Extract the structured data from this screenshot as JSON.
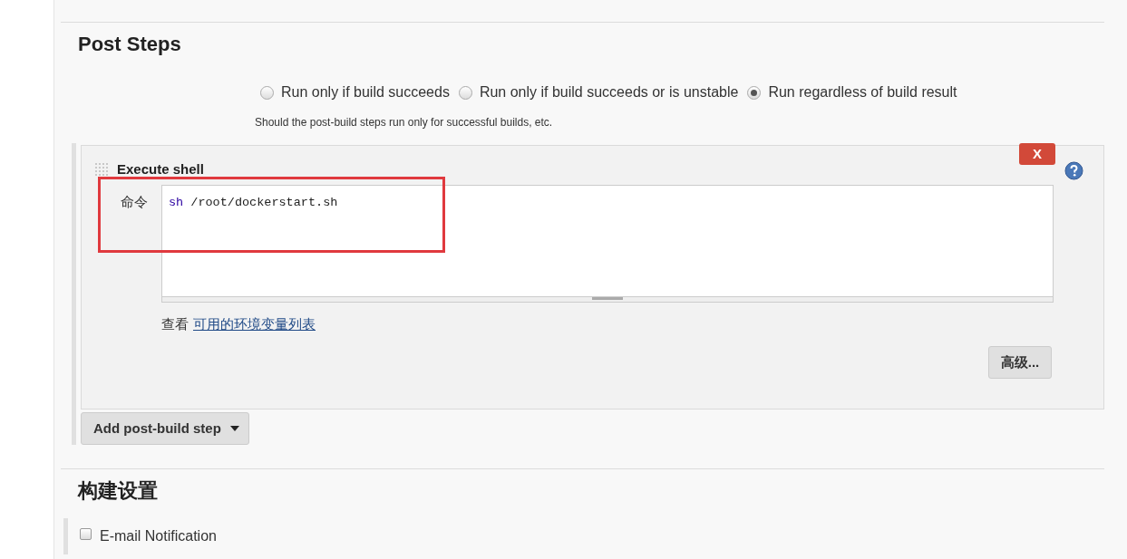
{
  "post_steps": {
    "title": "Post Steps",
    "options": [
      {
        "label": "Run only if build succeeds",
        "selected": false
      },
      {
        "label": "Run only if build succeeds or is unstable",
        "selected": false
      },
      {
        "label": "Run regardless of build result",
        "selected": true
      }
    ],
    "help": "Should the post-build steps run only for successful builds, etc.",
    "step": {
      "title": "Execute shell",
      "delete": "X",
      "command_label": "命令",
      "command": [
        {
          "text": "sh",
          "kind": "keyword"
        },
        {
          "text": " /root/dockerstart.sh",
          "kind": "plain"
        }
      ],
      "view_prefix": "查看",
      "env_link": "可用的环境变量列表",
      "advanced": "高级..."
    },
    "add_button": "Add post-build step"
  },
  "build_settings": {
    "title": "构建设置",
    "options": [
      {
        "label": "E-mail Notification",
        "checked": false
      }
    ]
  }
}
